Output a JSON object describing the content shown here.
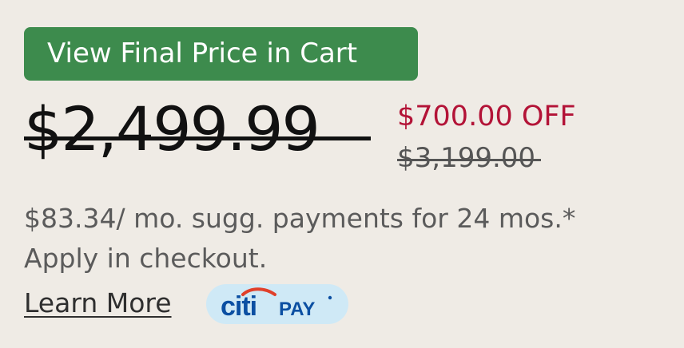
{
  "badge": {
    "label": "View Final Price in Cart"
  },
  "pricing": {
    "current_price": "$2,499.99",
    "discount": "$700.00 OFF",
    "original_price": "$3,199.00"
  },
  "financing": {
    "text": "$83.34/ mo. sugg. payments for 24 mos.* Apply in checkout.",
    "learn_more_label": "Learn More",
    "provider_logo": "citi-pay-logo",
    "provider_text": "citiPAY"
  },
  "colors": {
    "badge_green": "#3d8b4d",
    "discount_red": "#b31337",
    "background": "#efebe5",
    "citi_blue": "#0b4fa2",
    "citi_red": "#e0402b",
    "pill_blue": "#cfe9f6"
  }
}
